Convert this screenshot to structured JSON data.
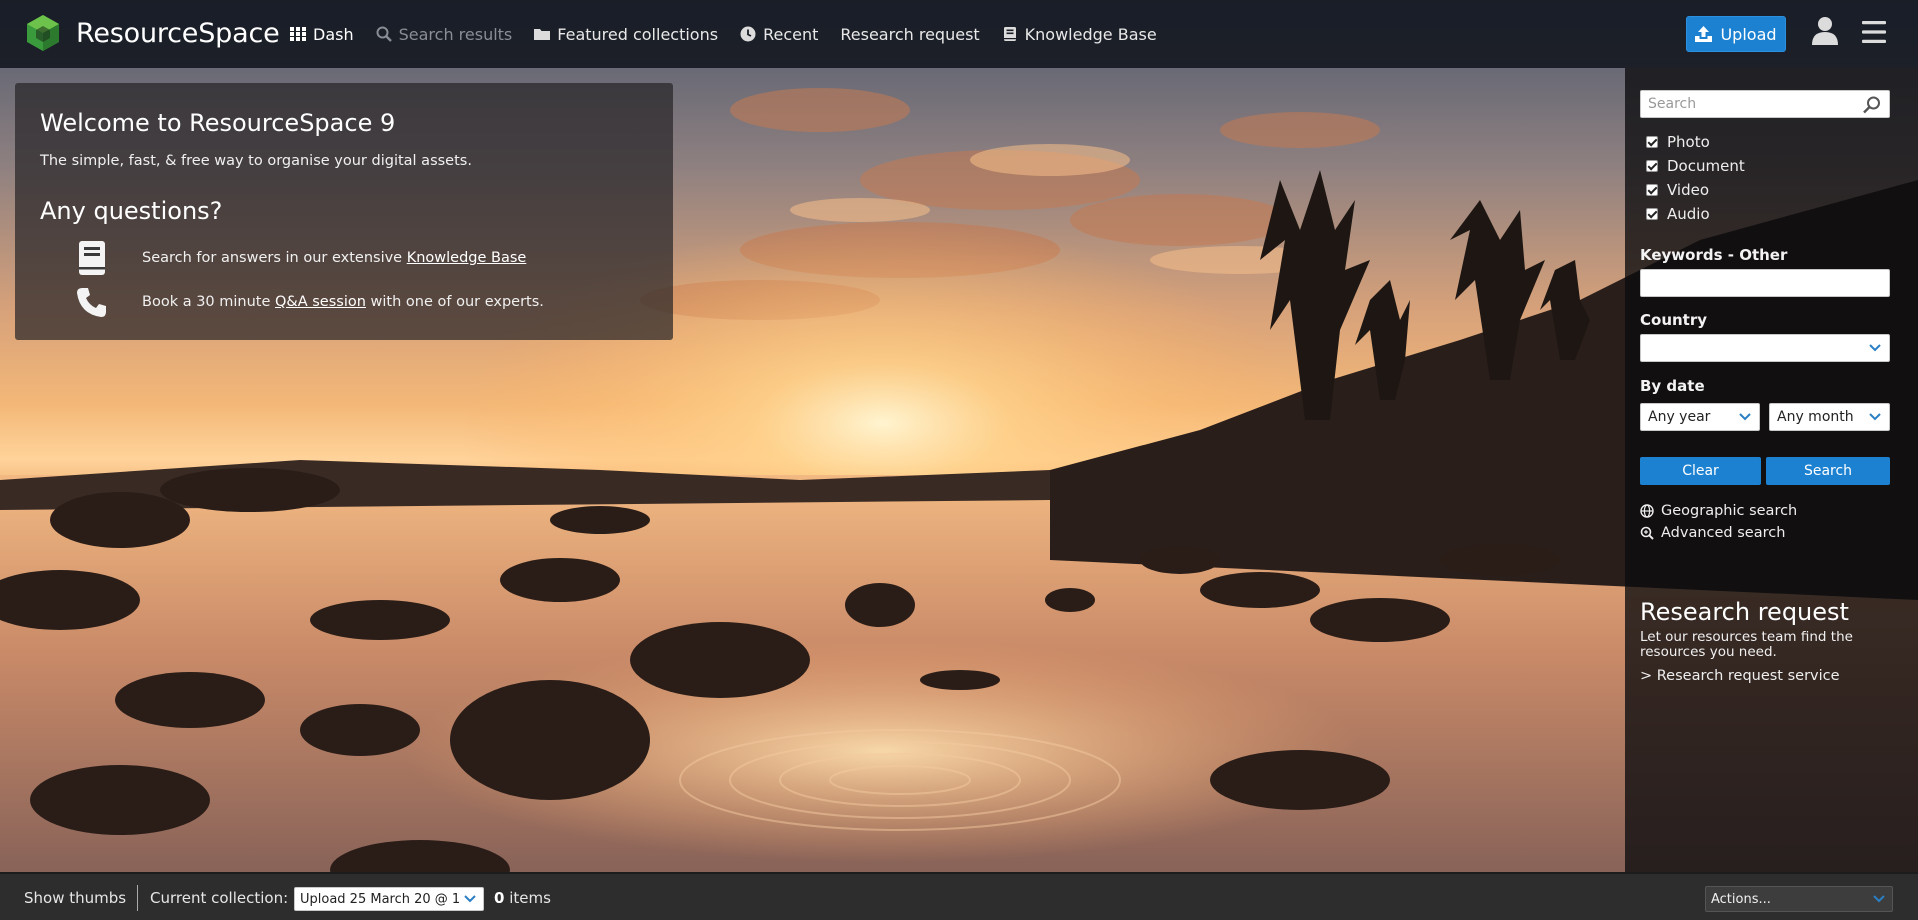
{
  "app": {
    "name": "ResourceSpace",
    "brand_color": "#3a9b3c",
    "accent_color": "#1c81d1"
  },
  "header": {
    "nav": [
      {
        "label": "Dash",
        "icon": "grid-icon",
        "state": "active"
      },
      {
        "label": "Search results",
        "icon": "search-icon",
        "state": "disabled"
      },
      {
        "label": "Featured collections",
        "icon": "folder-icon",
        "state": "normal"
      },
      {
        "label": "Recent",
        "icon": "clock-icon",
        "state": "normal"
      },
      {
        "label": "Research request",
        "icon": "",
        "state": "normal"
      },
      {
        "label": "Knowledge Base",
        "icon": "book-icon",
        "state": "normal"
      }
    ],
    "upload_label": "Upload",
    "icons": [
      "upload-icon",
      "user-icon",
      "hamburger-menu-icon"
    ]
  },
  "welcome": {
    "title": "Welcome to ResourceSpace 9",
    "subtitle": "The simple, fast, & free way to organise your digital assets.",
    "questions_title": "Any questions?",
    "kb_prefix": "Search for answers in our extensive ",
    "kb_link": "Knowledge Base",
    "qa_prefix": "Book a 30 minute ",
    "qa_link": "Q&A session",
    "qa_suffix": " with one of our experts."
  },
  "sidebar": {
    "search_placeholder": "Search",
    "resource_types": [
      {
        "label": "Photo",
        "checked": true
      },
      {
        "label": "Document",
        "checked": true
      },
      {
        "label": "Video",
        "checked": true
      },
      {
        "label": "Audio",
        "checked": true
      }
    ],
    "keywords_label": "Keywords - Other",
    "keywords_value": "",
    "country_label": "Country",
    "country_value": "",
    "bydate_label": "By date",
    "year_value": "Any year",
    "month_value": "Any month",
    "clear_label": "Clear",
    "search_label": "Search",
    "geo_search_label": "Geographic search",
    "adv_search_label": "Advanced search",
    "research_title": "Research request",
    "research_text": "Let our resources team find the resources you need.",
    "research_link": "> Research request service"
  },
  "bottom_bar": {
    "show_thumbs": "Show thumbs",
    "current_collection_label": "Current collection:",
    "collection_value": "Upload 25 March 20 @ 1",
    "items_count": "0",
    "items_label": " items",
    "actions_value": "Actions..."
  }
}
